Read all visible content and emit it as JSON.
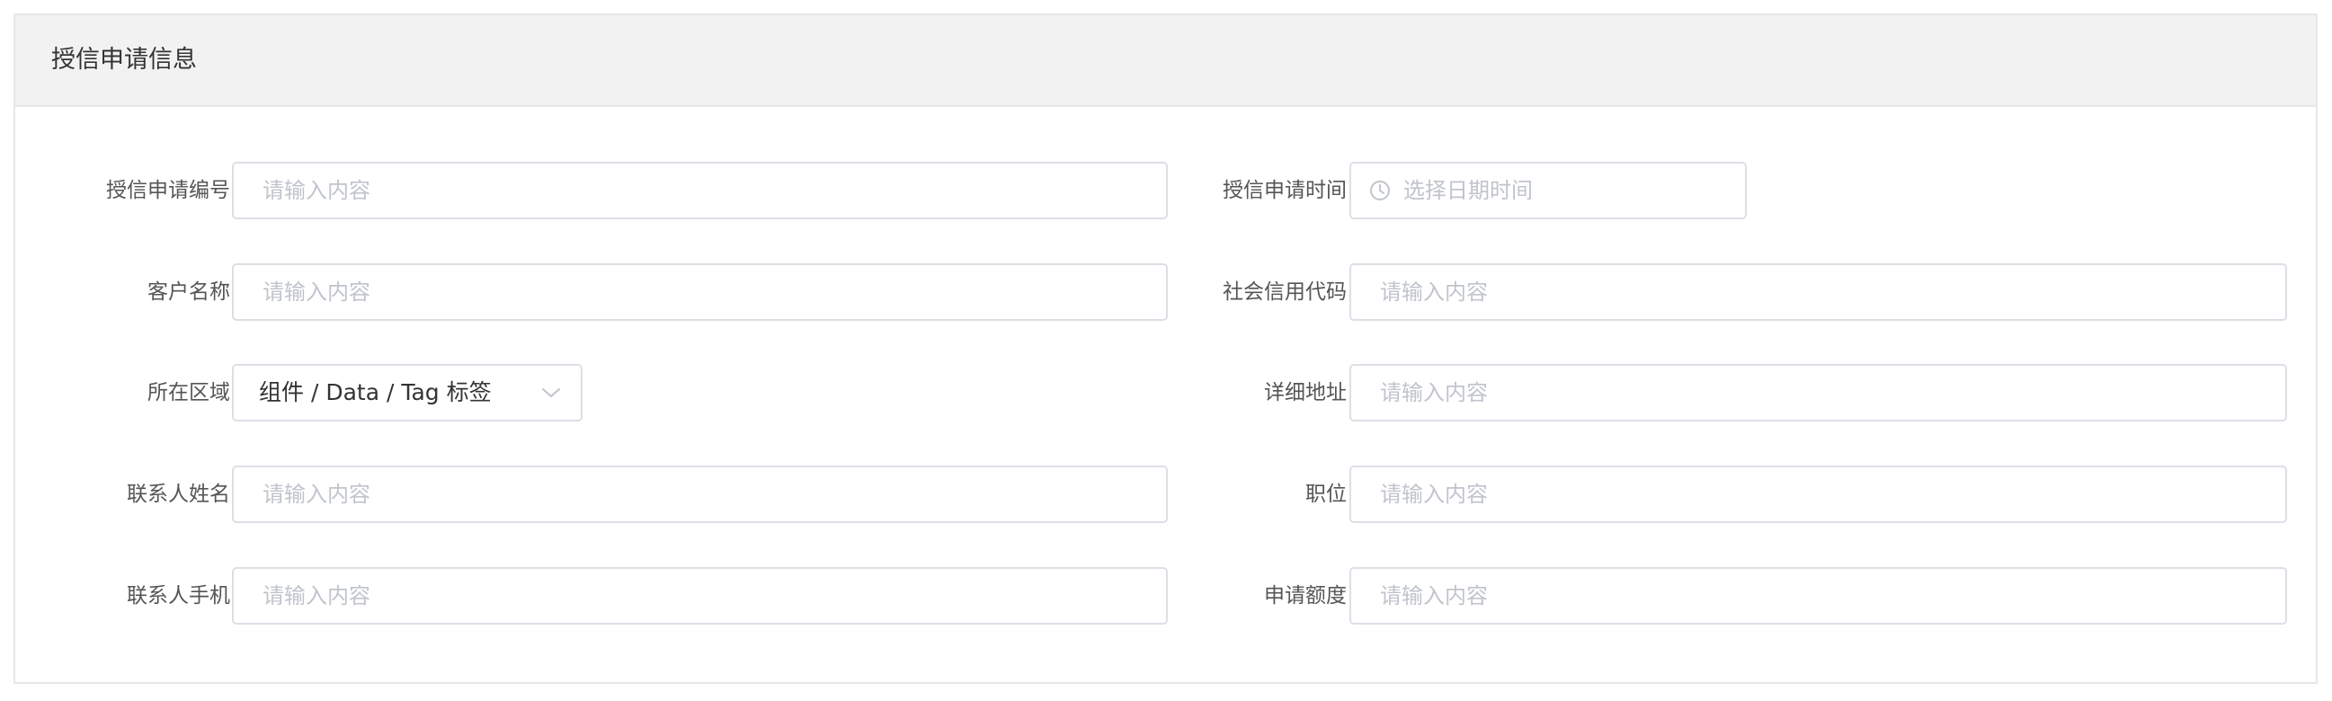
{
  "card": {
    "title": "授信申请信息"
  },
  "form": {
    "rows": [
      {
        "left": {
          "label": "授信申请编号",
          "placeholder": "请输入内容"
        },
        "right": {
          "label": "授信申请时间",
          "placeholder": "选择日期时间"
        }
      },
      {
        "left": {
          "label": "客户名称",
          "placeholder": "请输入内容"
        },
        "right": {
          "label": "社会信用代码",
          "placeholder": "请输入内容"
        }
      },
      {
        "left": {
          "label": "所在区域",
          "value": "组件 / Data / Tag 标签"
        },
        "right": {
          "label": "详细地址",
          "placeholder": "请输入内容"
        }
      },
      {
        "left": {
          "label": "联系人姓名",
          "placeholder": "请输入内容"
        },
        "right": {
          "label": "职位",
          "placeholder": "请输入内容"
        }
      },
      {
        "left": {
          "label": "联系人手机",
          "placeholder": "请输入内容"
        },
        "right": {
          "label": "申请额度",
          "placeholder": "请输入内容"
        }
      }
    ]
  },
  "icons": {
    "date": "clock-icon",
    "select": "chevron-down-icon"
  },
  "colors": {
    "border": "#dcdfe6",
    "placeholder": "#c0c4cc",
    "header_bg": "#f2f2f2"
  }
}
